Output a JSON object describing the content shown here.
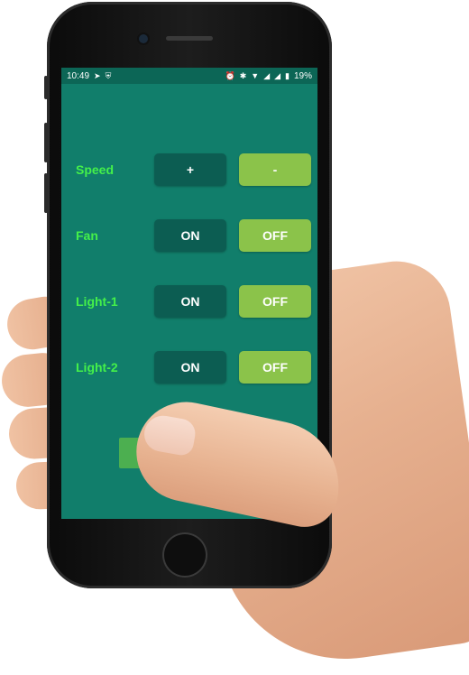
{
  "status_bar": {
    "time": "10:49",
    "left_icons": [
      "notification-icon",
      "shield-check-icon"
    ],
    "right_icons": [
      "alarm-icon",
      "bluetooth-icon",
      "wifi-icon",
      "signal-icon",
      "signal-icon",
      "battery-icon"
    ],
    "battery": "19%"
  },
  "controls": [
    {
      "label": "Speed",
      "left_button": "+",
      "right_button": "-"
    },
    {
      "label": "Fan",
      "left_button": "ON",
      "right_button": "OFF"
    },
    {
      "label": "Light-1",
      "left_button": "ON",
      "right_button": "OFF"
    },
    {
      "label": "Light-2",
      "left_button": "ON",
      "right_button": "OFF"
    }
  ],
  "colors": {
    "screen_bg": "#117e6b",
    "status_bar_bg": "#0c6656",
    "label": "#44f04a",
    "dark_button": "#0c5d52",
    "light_button": "#8bc34a",
    "bottom_button": "#4caf50"
  }
}
